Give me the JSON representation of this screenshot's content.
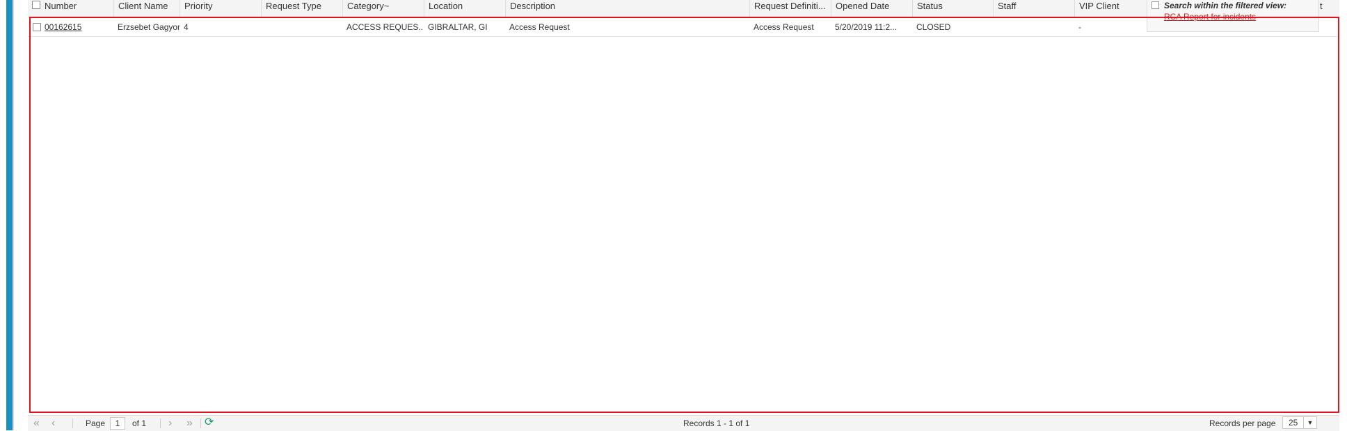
{
  "columns": [
    {
      "key": "number",
      "label": "Number"
    },
    {
      "key": "client",
      "label": "Client Name"
    },
    {
      "key": "priority",
      "label": "Priority"
    },
    {
      "key": "reqtype",
      "label": "Request Type"
    },
    {
      "key": "category",
      "label": "Category~"
    },
    {
      "key": "location",
      "label": "Location"
    },
    {
      "key": "description",
      "label": "Description"
    },
    {
      "key": "reqdef",
      "label": "Request Definiti..."
    },
    {
      "key": "opened",
      "label": "Opened Date"
    },
    {
      "key": "status",
      "label": "Status"
    },
    {
      "key": "staff",
      "label": "Staff"
    },
    {
      "key": "vip",
      "label": "VIP Client"
    }
  ],
  "extra_header": "t",
  "rows": [
    {
      "number": "00162615",
      "client": "Erzsebet Gagyor",
      "priority": "4",
      "reqtype": "",
      "category": "ACCESS REQUES...",
      "location": "GIBRALTAR, GI",
      "description": "Access Request",
      "reqdef": "Access Request",
      "opened": "5/20/2019 11:2...",
      "status": "CLOSED",
      "staff": "",
      "vip": "-"
    }
  ],
  "search_panel": {
    "label": "Search within the filtered view:",
    "link": "RCA Report for incidents"
  },
  "pager": {
    "first": "«",
    "prev": "‹",
    "page_label": "Page",
    "page_value": "1",
    "of_label": "of 1",
    "next": "›",
    "last": "»",
    "refresh": "⟳",
    "records_info": "Records 1 - 1 of 1",
    "rpp_label": "Records per page",
    "rpp_value": "25",
    "rpp_arrow": "▼"
  },
  "colors": {
    "accent": "#1b8fbf",
    "highlight": "#e0141e",
    "link_red": "#c62828",
    "refresh": "#1a9a6c"
  }
}
